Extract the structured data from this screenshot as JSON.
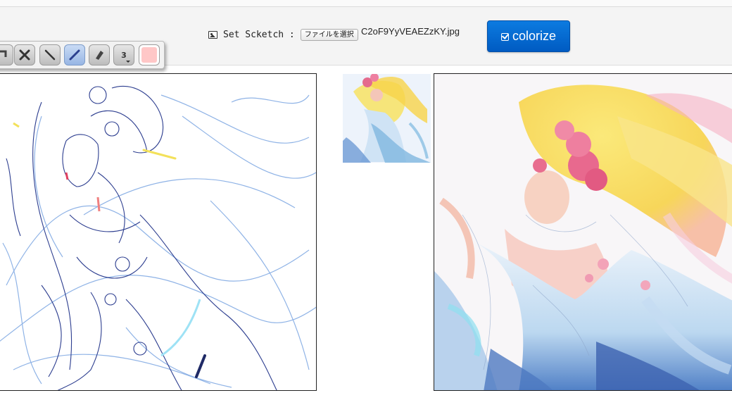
{
  "header": {
    "set_label": "Set Scketch :",
    "file_button_label": "ファイルを選択",
    "file_name": "C2oF9YyVEAEZzKY.jpg",
    "colorize_label": "colorize",
    "colorize_icon": "check-square-icon",
    "set_icon": "picture-icon"
  },
  "toolbar": {
    "tools": [
      {
        "name": "undo",
        "icon": "undo-icon"
      },
      {
        "name": "clear",
        "icon": "close-icon"
      },
      {
        "name": "line",
        "icon": "line-icon"
      },
      {
        "name": "pen",
        "icon": "pen-icon",
        "active": true
      },
      {
        "name": "eraser",
        "icon": "eraser-icon"
      }
    ],
    "brush_size": "3",
    "current_color": "#ffc7c7"
  },
  "colors": {
    "accent": "#0068d0",
    "sketch_line_dark": "#2c3d8f",
    "sketch_line_light": "#8fb3e6"
  }
}
